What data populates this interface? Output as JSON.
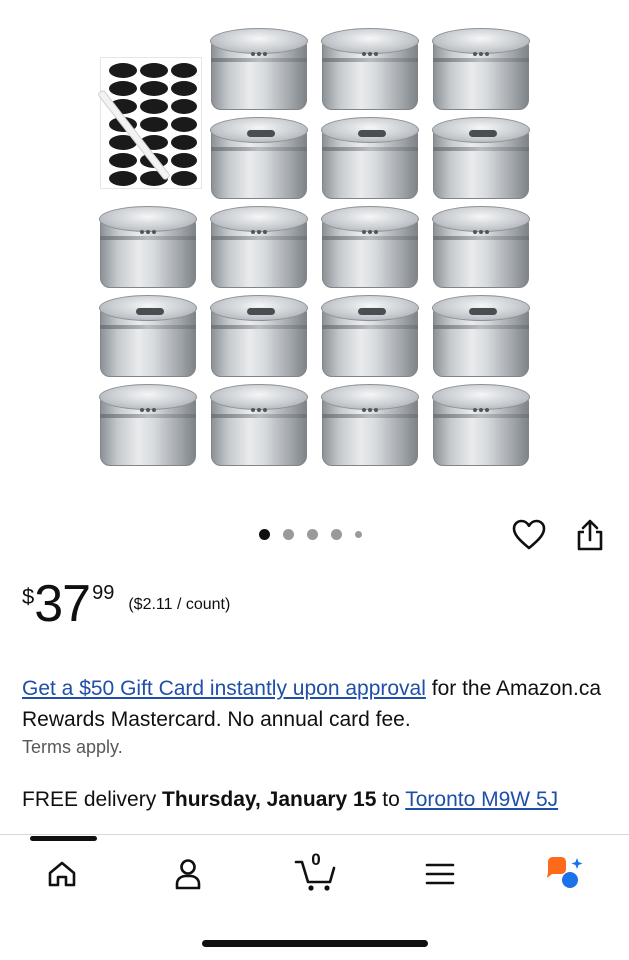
{
  "product": {
    "image_alt": "",
    "carousel": {
      "count": 5,
      "active_index": 0
    }
  },
  "actions": {
    "favorite_icon": "heart-icon",
    "share_icon": "share-icon"
  },
  "price": {
    "currency": "$",
    "whole": "37",
    "fraction": "99",
    "unit_price": "($2.11 / count)"
  },
  "promo": {
    "link_text": "Get a $50 Gift Card instantly upon approval",
    "rest_text": " for the Amazon.ca Rewards Mastercard. No annual card fee.",
    "terms": "Terms apply."
  },
  "delivery": {
    "prefix": "FREE delivery ",
    "date": "Thursday, January 15",
    "middle": " to ",
    "location": "Toronto M9W 5J"
  },
  "bottom_nav": {
    "items": [
      {
        "name": "home",
        "icon": "home-icon"
      },
      {
        "name": "account",
        "icon": "person-icon"
      },
      {
        "name": "cart",
        "icon": "cart-icon",
        "count": "0"
      },
      {
        "name": "menu",
        "icon": "hamburger-menu-icon"
      },
      {
        "name": "rufus",
        "icon": "ai-assistant-icon"
      }
    ]
  },
  "colors": {
    "link": "#1f4fa8",
    "text": "#0f1111",
    "muted": "#565959",
    "assistant_orange": "#ff6a1a",
    "assistant_blue": "#1a73e8"
  }
}
